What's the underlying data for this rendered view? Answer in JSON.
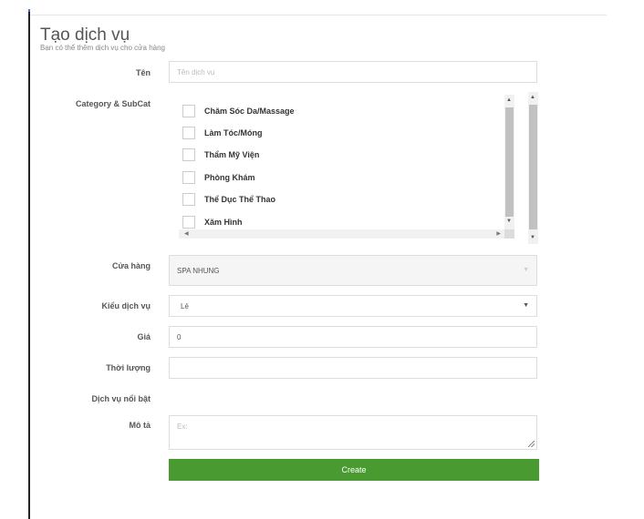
{
  "header": {
    "title": "Tạo dịch vụ",
    "subtitle": "Bạn có thể thêm dịch vụ cho cửa hàng"
  },
  "form": {
    "name_label": "Tên",
    "name_placeholder": "Tên dịch vụ",
    "category_label": "Category & SubCat",
    "categories": [
      {
        "label": "Chăm Sóc Da/Massage",
        "checked": false
      },
      {
        "label": "Làm Tóc/Móng",
        "checked": false
      },
      {
        "label": "Thẩm Mỹ Viện",
        "checked": false
      },
      {
        "label": "Phòng Khám",
        "checked": false
      },
      {
        "label": "Thể Dục Thể Thao",
        "checked": false
      },
      {
        "label": "Xăm Hình",
        "checked": false
      }
    ],
    "store_label": "Cửa hàng",
    "store_value": "SPA NHUNG",
    "service_type_label": "Kiểu dịch vụ",
    "service_type_value": "Lẻ",
    "price_label": "Giá",
    "price_value": "0",
    "duration_label": "Thời lượng",
    "duration_value": "",
    "featured_label": "Dịch vụ nổi bật",
    "description_label": "Mô tả",
    "description_placeholder": "Ex:",
    "create_label": "Create"
  },
  "colors": {
    "create_button": "#4a9a32",
    "accent_tick": "#3a7bd5"
  }
}
